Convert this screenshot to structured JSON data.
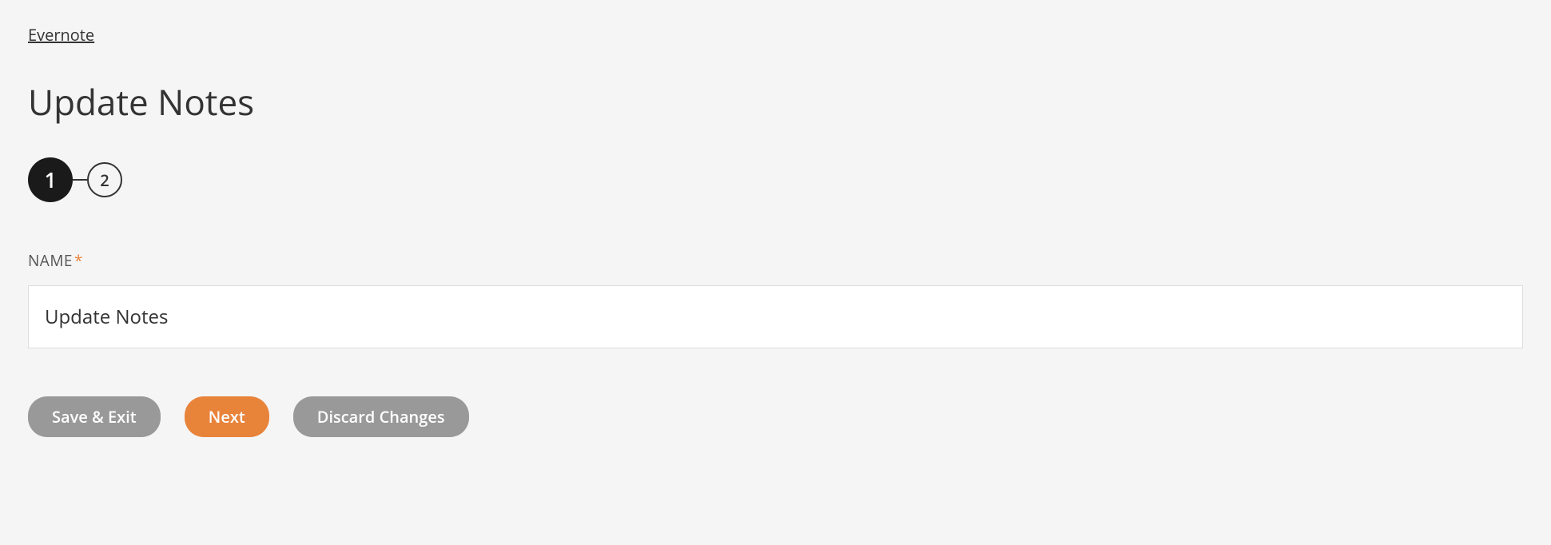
{
  "breadcrumb": {
    "parent": "Evernote"
  },
  "page": {
    "title": "Update Notes"
  },
  "stepper": {
    "step1": "1",
    "step2": "2"
  },
  "form": {
    "name_label": "NAME",
    "required_mark": "*",
    "name_value": "Update Notes"
  },
  "buttons": {
    "save_exit": "Save & Exit",
    "next": "Next",
    "discard": "Discard Changes"
  }
}
